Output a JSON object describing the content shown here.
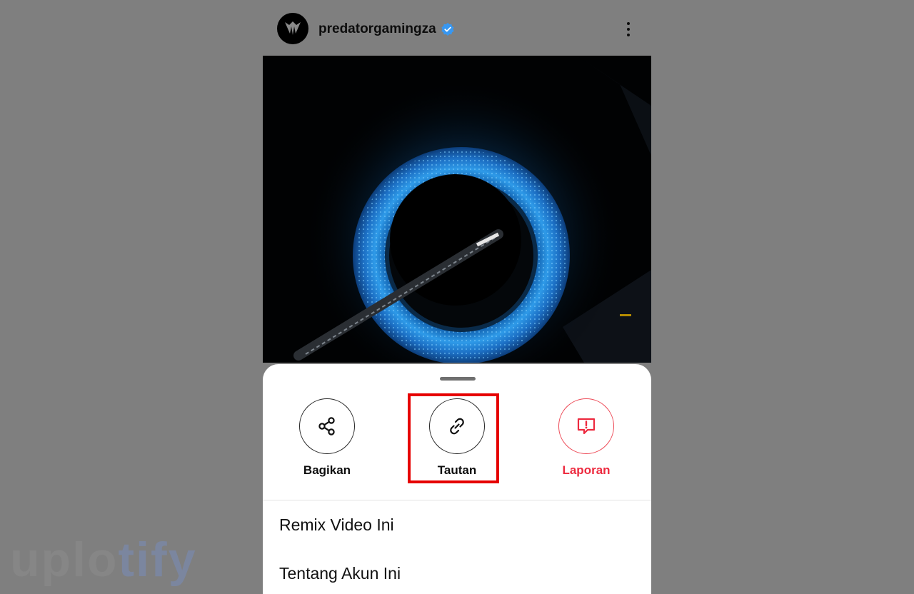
{
  "post": {
    "username": "predatorgamingza",
    "verified": true
  },
  "share_sheet": {
    "actions": [
      {
        "label": "Bagikan",
        "icon": "share-icon"
      },
      {
        "label": "Tautan",
        "icon": "link-icon"
      },
      {
        "label": "Laporan",
        "icon": "report-icon"
      }
    ],
    "menu": [
      {
        "label": "Remix Video Ini"
      },
      {
        "label": "Tentang Akun Ini"
      }
    ]
  },
  "watermark": {
    "part1": "uplo",
    "part2": "tify"
  },
  "colors": {
    "overlay": "#7f7f7f",
    "danger": "#ed2a3f",
    "highlight": "#e60000",
    "verified": "#3897f0"
  }
}
